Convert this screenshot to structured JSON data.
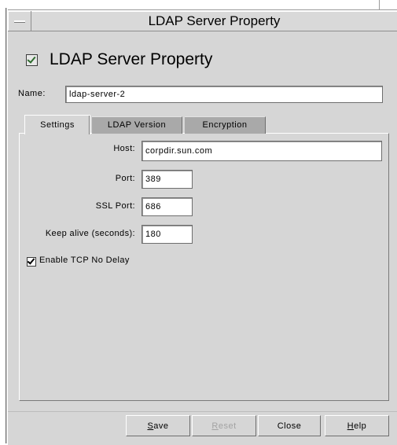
{
  "window": {
    "title": "LDAP Server Property"
  },
  "header": {
    "checked": true,
    "label": "LDAP Server Property"
  },
  "name_field": {
    "label": "Name:",
    "value": "ldap-server-2"
  },
  "tabs": [
    {
      "label": "Settings",
      "active": true
    },
    {
      "label": "LDAP Version",
      "active": false
    },
    {
      "label": "Encryption",
      "active": false
    }
  ],
  "settings": {
    "host": {
      "label": "Host:",
      "value": "corpdir.sun.com"
    },
    "port": {
      "label": "Port:",
      "value": "389"
    },
    "ssl_port": {
      "label": "SSL Port:",
      "value": "686"
    },
    "keep_alive": {
      "label": "Keep alive (seconds):",
      "value": "180"
    },
    "tcp_no_delay": {
      "label": "Enable TCP No Delay",
      "checked": true
    }
  },
  "buttons": {
    "save": {
      "first": "S",
      "rest": "ave",
      "enabled": true
    },
    "reset": {
      "first": "R",
      "rest": "eset",
      "enabled": false
    },
    "close": {
      "label": "Close",
      "enabled": true
    },
    "help": {
      "first": "H",
      "rest": "elp",
      "enabled": true
    }
  },
  "colors": {
    "window_bg": "#d6d6d6",
    "inactive_tab": "#a9a9a9",
    "disabled_text": "#a3a3a3"
  }
}
